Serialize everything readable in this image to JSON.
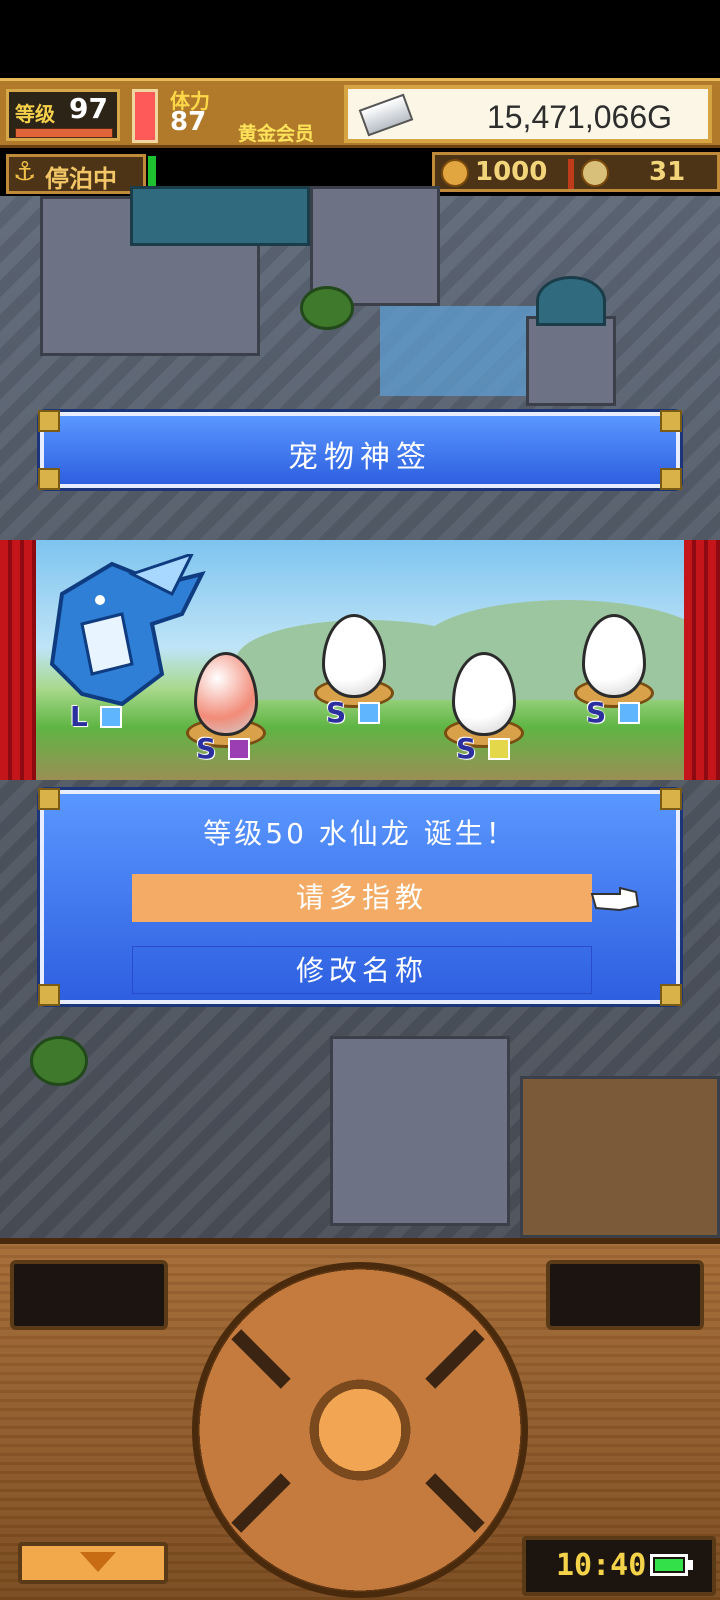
{
  "hud": {
    "level_label": "等级",
    "level_value": "97",
    "stamina_label": "体力",
    "stamina_value": "87",
    "membership": "黄金会员",
    "money": "15,471,066G",
    "dock_status": "停泊中",
    "resource_1": "1000",
    "resource_2": "31"
  },
  "title_panel": {
    "title": "宠物神签"
  },
  "stage": {
    "dragon_rank": "L",
    "eggs": [
      {
        "rank": "S",
        "color": "#f28b78"
      },
      {
        "rank": "S",
        "color": "#ffffff"
      },
      {
        "rank": "S",
        "color": "#ffffff"
      },
      {
        "rank": "S",
        "color": "#ffffff"
      }
    ]
  },
  "dialog": {
    "message": "等级50 水仙龙 诞生！",
    "option_1": "请多指教",
    "option_2": "修改名称"
  },
  "console": {
    "clock": "10:40"
  },
  "colors": {
    "panel_blue": "#3a6ef0",
    "highlight_orange": "#f3ab65",
    "gold": "#d9b24a",
    "battery_green": "#33e04a"
  }
}
